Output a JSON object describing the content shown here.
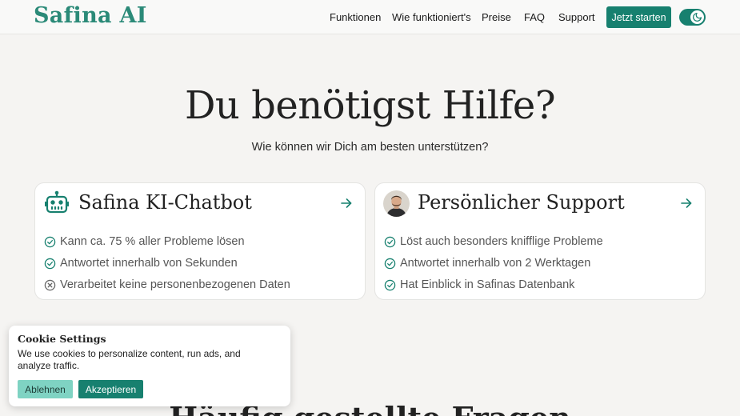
{
  "header": {
    "logo": "Safina AI",
    "nav": [
      "Funktionen",
      "Wie funktioniert's",
      "Preise",
      "FAQ",
      "Support"
    ],
    "cta_label": "Jetzt starten",
    "theme_toggle_icon": "moon-icon"
  },
  "hero": {
    "title": "Du benötigst Hilfe?",
    "subtitle": "Wie können wir Dich am besten unterstützen?"
  },
  "cards": [
    {
      "title": "Safina KI-Chatbot",
      "icon": "robot-icon",
      "features": [
        {
          "text": "Kann ca. 75 % aller Probleme lösen",
          "icon": "check-circle-icon"
        },
        {
          "text": "Antwortet innerhalb von Sekunden",
          "icon": "check-circle-icon"
        },
        {
          "text": "Verarbeitet keine personenbezogenen Daten",
          "icon": "x-circle-icon"
        }
      ]
    },
    {
      "title": "Persönlicher Support",
      "icon": "avatar",
      "features": [
        {
          "text": "Löst auch besonders knifflige Probleme",
          "icon": "check-circle-icon"
        },
        {
          "text": "Antwortet innerhalb von 2 Werktagen",
          "icon": "check-circle-icon"
        },
        {
          "text": "Hat Einblick in Safinas Datenbank",
          "icon": "check-circle-icon"
        }
      ]
    }
  ],
  "faq": {
    "title": "Häufig gestellte Fragen"
  },
  "cookie_banner": {
    "title": "Cookie Settings",
    "text": "We use cookies to personalize content, run ads, and analyze traffic.",
    "decline_label": "Ablehnen",
    "accept_label": "Akzeptieren"
  },
  "colors": {
    "brand": "#17806f",
    "brand_light": "#7fd3c3",
    "background": "#f5f4f2"
  }
}
